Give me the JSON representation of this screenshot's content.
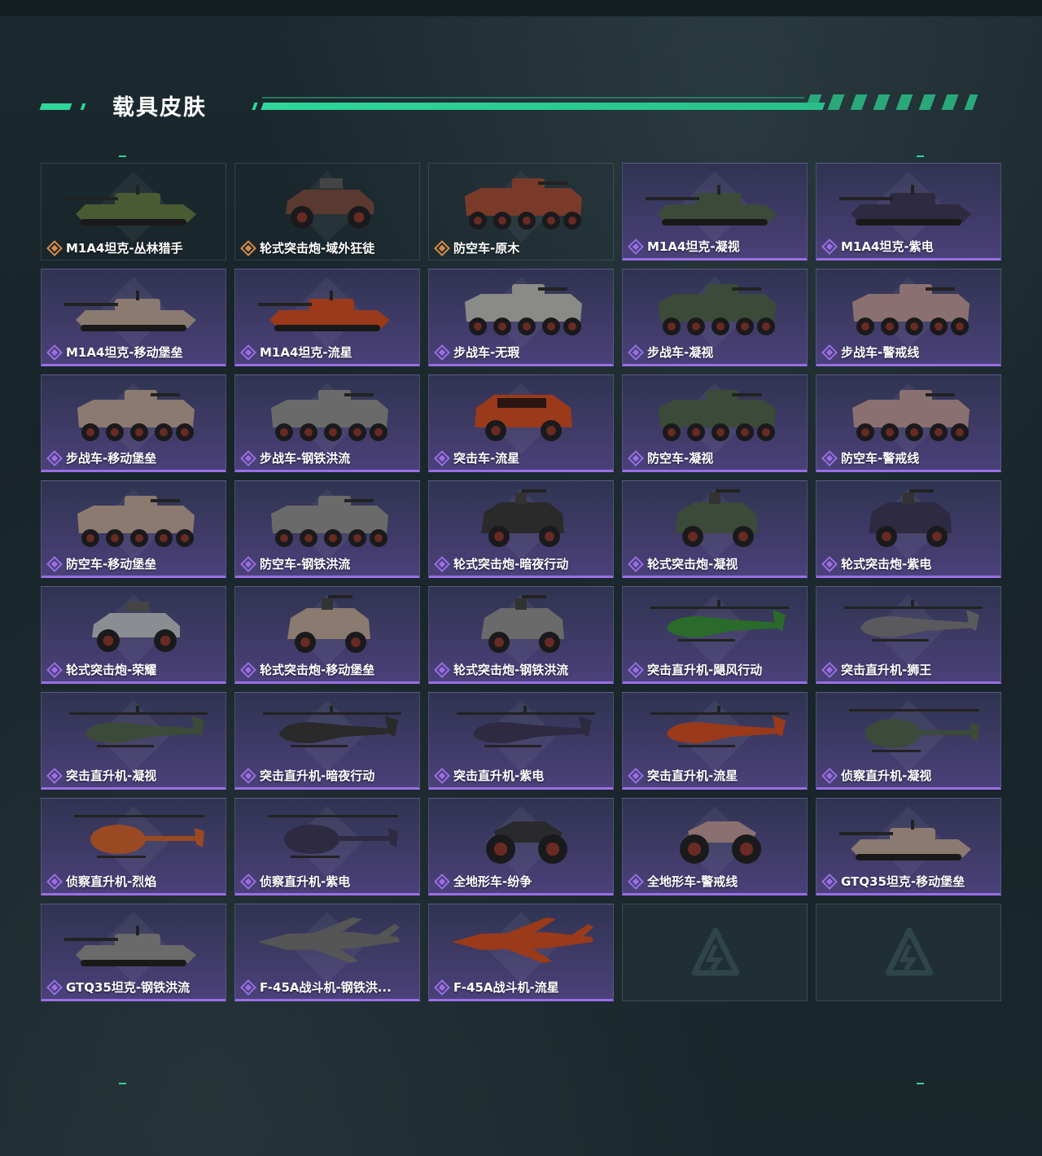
{
  "page": {
    "title": "载具皮肤"
  },
  "colors": {
    "accent": "#2fd69a",
    "epic": "#9a6ee6",
    "legendary": "#d98a48"
  },
  "skins": [
    {
      "name": "M1A4坦克-丛林猎手",
      "rarity": "legendary",
      "vehicle": "tank",
      "icon": "tank-icon"
    },
    {
      "name": "轮式突击炮-域外狂徒",
      "rarity": "legendary",
      "vehicle": "buggy",
      "icon": "armored-car-icon"
    },
    {
      "name": "防空车-原木",
      "rarity": "legendary",
      "vehicle": "apc",
      "icon": "apc-icon"
    },
    {
      "name": "M1A4坦克-凝视",
      "rarity": "epic",
      "vehicle": "tank",
      "icon": "tank-icon"
    },
    {
      "name": "M1A4坦克-紫电",
      "rarity": "epic",
      "vehicle": "tank",
      "icon": "tank-icon"
    },
    {
      "name": "M1A4坦克-移动堡垒",
      "rarity": "epic",
      "vehicle": "tank",
      "icon": "tank-icon"
    },
    {
      "name": "M1A4坦克-流星",
      "rarity": "epic",
      "vehicle": "tank",
      "icon": "tank-icon"
    },
    {
      "name": "步战车-无瑕",
      "rarity": "epic",
      "vehicle": "apc",
      "icon": "apc-icon"
    },
    {
      "name": "步战车-凝视",
      "rarity": "epic",
      "vehicle": "apc",
      "icon": "apc-icon"
    },
    {
      "name": "步战车-警戒线",
      "rarity": "epic",
      "vehicle": "apc",
      "icon": "apc-icon"
    },
    {
      "name": "步战车-移动堡垒",
      "rarity": "epic",
      "vehicle": "apc",
      "icon": "apc-icon"
    },
    {
      "name": "步战车-钢铁洪流",
      "rarity": "epic",
      "vehicle": "apc",
      "icon": "apc-icon"
    },
    {
      "name": "突击车-流星",
      "rarity": "epic",
      "vehicle": "truck",
      "icon": "truck-icon"
    },
    {
      "name": "防空车-凝视",
      "rarity": "epic",
      "vehicle": "apc",
      "icon": "apc-icon"
    },
    {
      "name": "防空车-警戒线",
      "rarity": "epic",
      "vehicle": "apc",
      "icon": "apc-icon"
    },
    {
      "name": "防空车-移动堡垒",
      "rarity": "epic",
      "vehicle": "apc",
      "icon": "apc-icon"
    },
    {
      "name": "防空车-钢铁洪流",
      "rarity": "epic",
      "vehicle": "apc",
      "icon": "apc-icon"
    },
    {
      "name": "轮式突击炮-暗夜行动",
      "rarity": "epic",
      "vehicle": "armored",
      "icon": "armored-car-icon"
    },
    {
      "name": "轮式突击炮-凝视",
      "rarity": "epic",
      "vehicle": "armored",
      "icon": "armored-car-icon"
    },
    {
      "name": "轮式突击炮-紫电",
      "rarity": "epic",
      "vehicle": "armored",
      "icon": "armored-car-icon"
    },
    {
      "name": "轮式突击炮-荣耀",
      "rarity": "epic",
      "vehicle": "buggy",
      "icon": "armored-car-icon"
    },
    {
      "name": "轮式突击炮-移动堡垒",
      "rarity": "epic",
      "vehicle": "armored",
      "icon": "armored-car-icon"
    },
    {
      "name": "轮式突击炮-钢铁洪流",
      "rarity": "epic",
      "vehicle": "armored",
      "icon": "armored-car-icon"
    },
    {
      "name": "突击直升机-飓风行动",
      "rarity": "epic",
      "vehicle": "heli",
      "icon": "helicopter-icon"
    },
    {
      "name": "突击直升机-狮王",
      "rarity": "epic",
      "vehicle": "heli",
      "icon": "helicopter-icon"
    },
    {
      "name": "突击直升机-凝视",
      "rarity": "epic",
      "vehicle": "heli",
      "icon": "helicopter-icon"
    },
    {
      "name": "突击直升机-暗夜行动",
      "rarity": "epic",
      "vehicle": "heli",
      "icon": "helicopter-icon"
    },
    {
      "name": "突击直升机-紫电",
      "rarity": "epic",
      "vehicle": "heli",
      "icon": "helicopter-icon"
    },
    {
      "name": "突击直升机-流星",
      "rarity": "epic",
      "vehicle": "heli",
      "icon": "helicopter-icon"
    },
    {
      "name": "侦察直升机-凝视",
      "rarity": "epic",
      "vehicle": "scout",
      "icon": "scout-helicopter-icon"
    },
    {
      "name": "侦察直升机-烈焰",
      "rarity": "epic",
      "vehicle": "scout",
      "icon": "scout-helicopter-icon"
    },
    {
      "name": "侦察直升机-紫电",
      "rarity": "epic",
      "vehicle": "scout",
      "icon": "scout-helicopter-icon"
    },
    {
      "name": "全地形车-纷争",
      "rarity": "epic",
      "vehicle": "atv",
      "icon": "atv-icon"
    },
    {
      "name": "全地形车-警戒线",
      "rarity": "epic",
      "vehicle": "atv",
      "icon": "atv-icon"
    },
    {
      "name": "GTQ35坦克-移动堡垒",
      "rarity": "epic",
      "vehicle": "tank",
      "icon": "tank-icon"
    },
    {
      "name": "GTQ35坦克-钢铁洪流",
      "rarity": "epic",
      "vehicle": "tank",
      "icon": "tank-icon"
    },
    {
      "name": "F-45A战斗机-钢铁洪...",
      "rarity": "epic",
      "vehicle": "jet",
      "icon": "fighter-jet-icon"
    },
    {
      "name": "F-45A战斗机-流星",
      "rarity": "epic",
      "vehicle": "jet",
      "icon": "fighter-jet-icon"
    },
    {
      "name": "",
      "rarity": "empty",
      "vehicle": "none",
      "icon": "empty-slot-logo-icon"
    },
    {
      "name": "",
      "rarity": "empty",
      "vehicle": "none",
      "icon": "empty-slot-logo-icon"
    }
  ]
}
